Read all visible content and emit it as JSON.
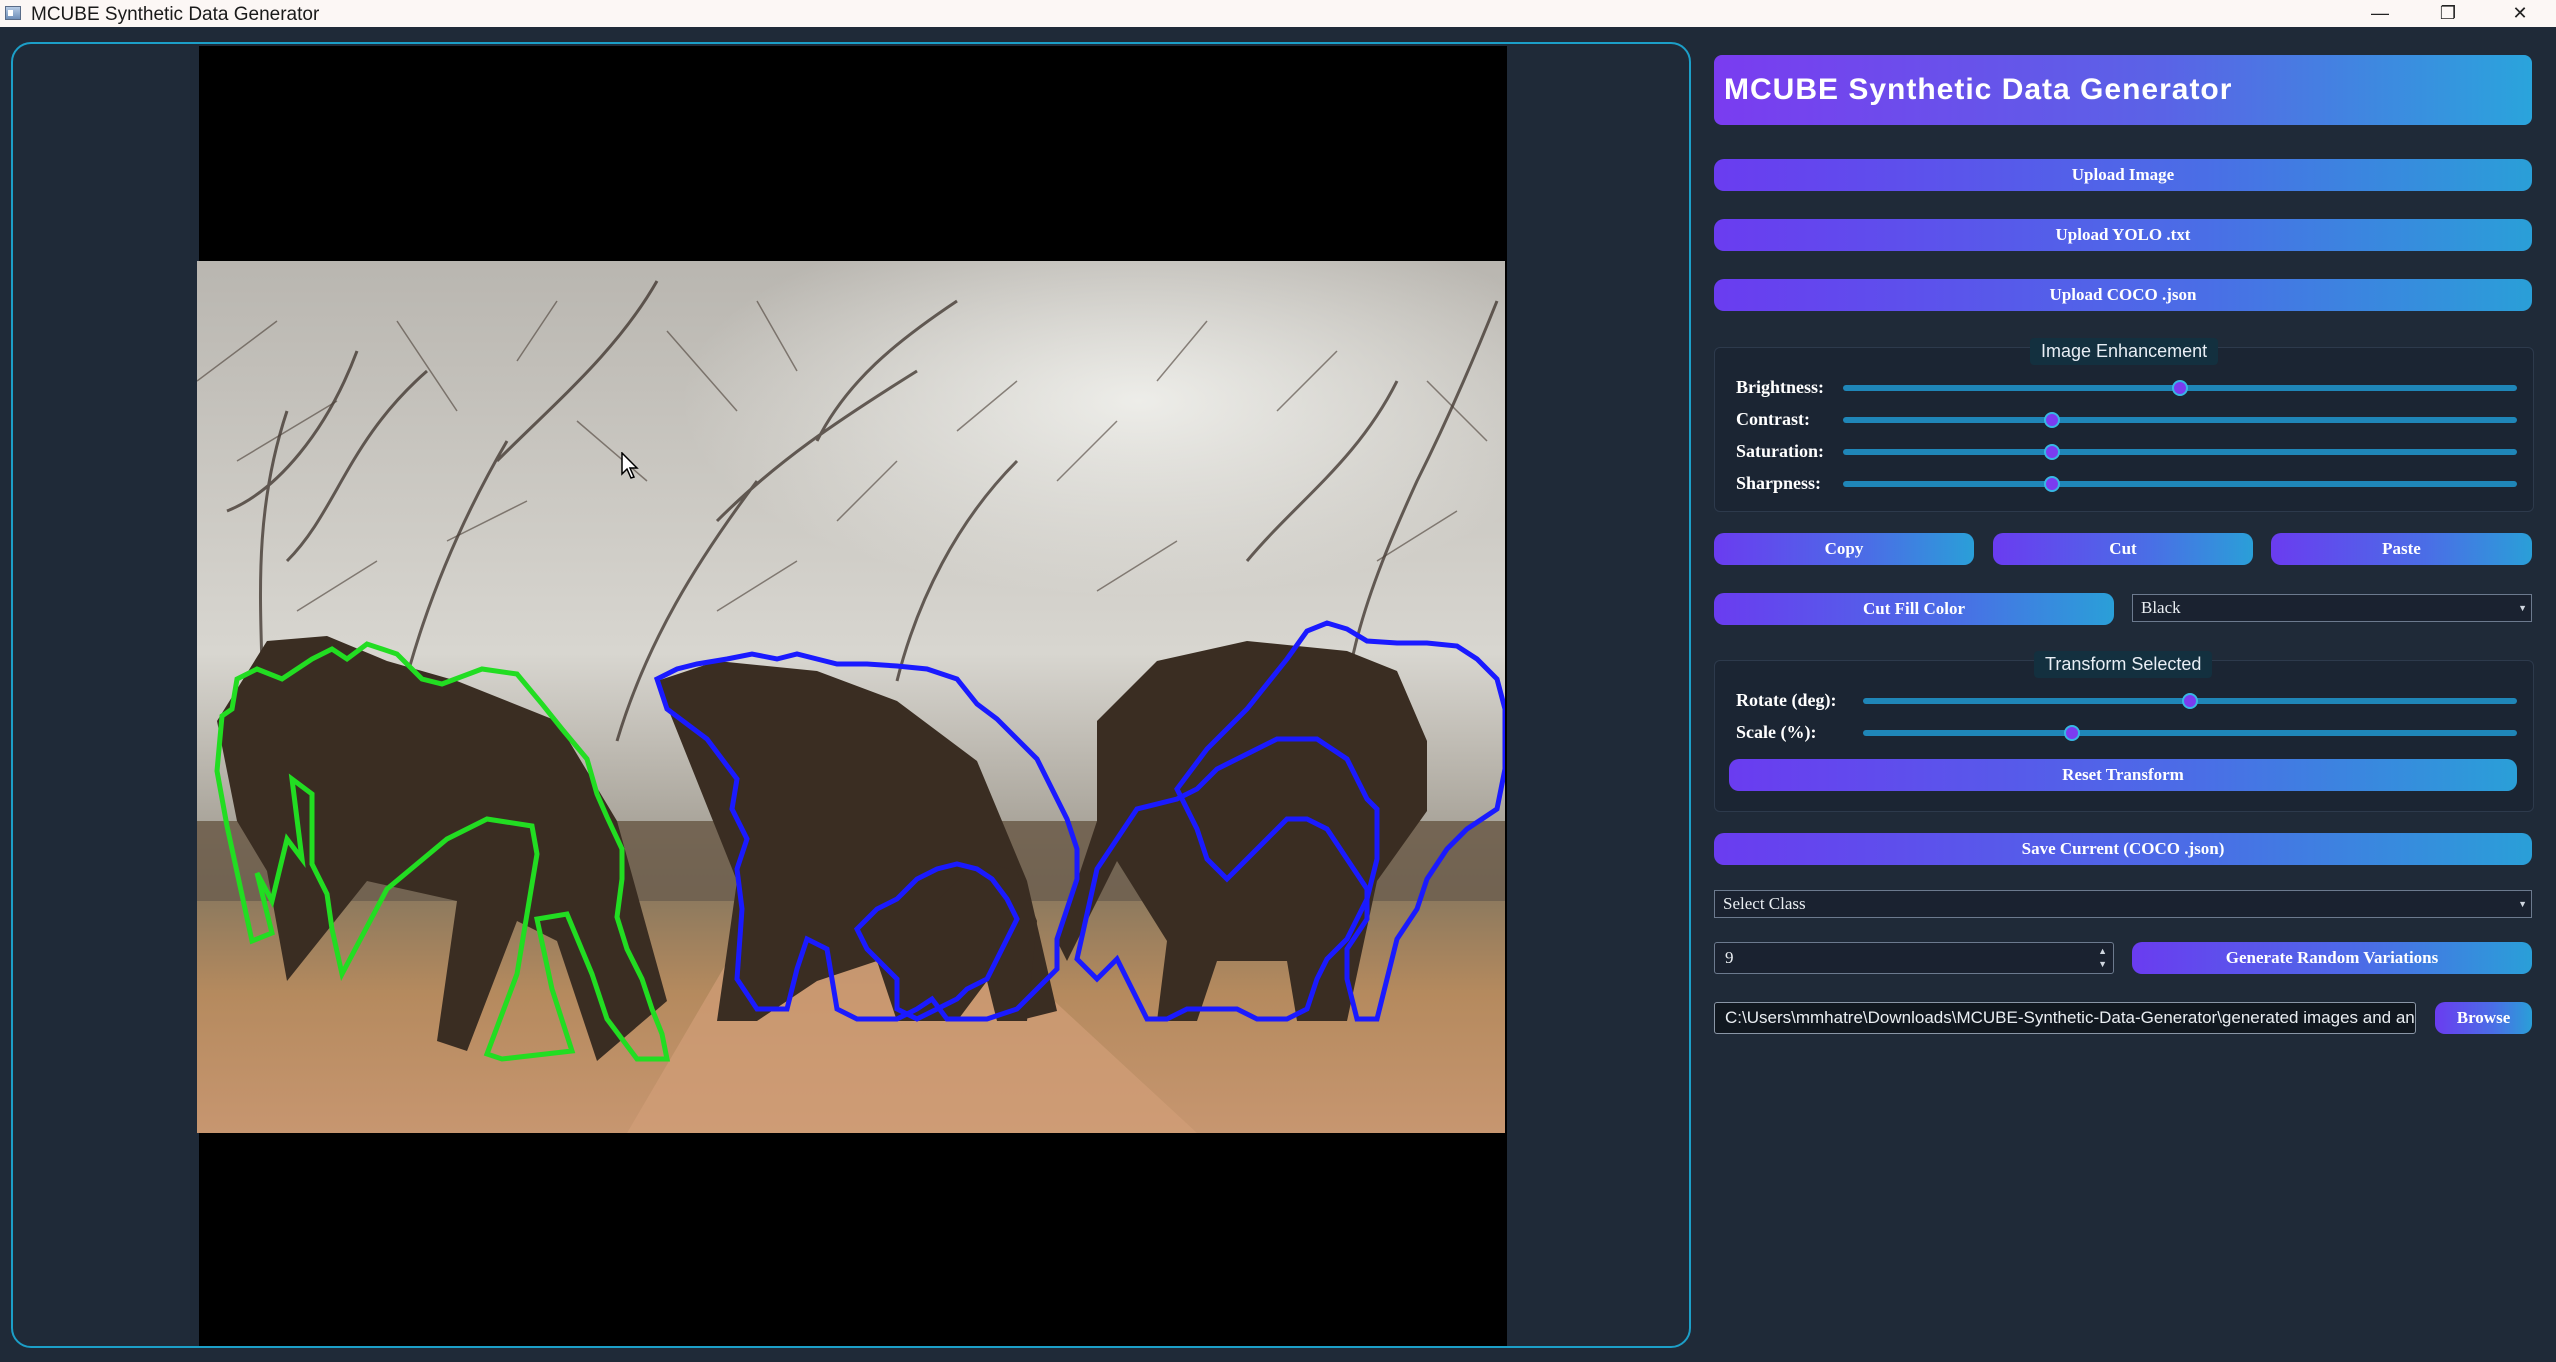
{
  "window": {
    "title": "MCUBE Synthetic Data Generator",
    "min_glyph": "—",
    "max_glyph": "❐",
    "close_glyph": "✕"
  },
  "header": {
    "title": "MCUBE Synthetic Data Generator"
  },
  "buttons": {
    "upload_image": "Upload Image",
    "upload_yolo": "Upload YOLO .txt",
    "upload_coco": "Upload COCO .json",
    "copy": "Copy",
    "cut": "Cut",
    "paste": "Paste",
    "cut_fill_color": "Cut Fill Color",
    "reset_transform": "Reset Transform",
    "save_current": "Save Current (COCO .json)",
    "generate": "Generate Random Variations",
    "browse": "Browse"
  },
  "enhancement": {
    "title": "Image Enhancement",
    "sliders": [
      {
        "label": "Brightness:",
        "value": 0.5
      },
      {
        "label": "Contrast:",
        "value": 0.31
      },
      {
        "label": "Saturation:",
        "value": 0.31
      },
      {
        "label": "Sharpness:",
        "value": 0.31
      }
    ]
  },
  "transform": {
    "title": "Transform Selected",
    "sliders": [
      {
        "label": "Rotate (deg):",
        "value": 0.5
      },
      {
        "label": "Scale (%):",
        "value": 0.32
      }
    ]
  },
  "fill_color": {
    "selected": "Black"
  },
  "class_select": {
    "selected": "Select Class"
  },
  "variations": {
    "count": "9"
  },
  "output_path": {
    "value": "C:\\Users\\mmhatre\\Downloads\\MCUBE-Synthetic-Data-Generator\\generated images and annos"
  },
  "colors": {
    "accent_purple": "#7a3cf0",
    "accent_blue": "#2aa4dc",
    "annotation_green": "#22dd22",
    "annotation_blue": "#1a1aff",
    "panel_bg": "#1f2a38"
  },
  "icons": {
    "app": "app-window-icon",
    "cursor": "mouse-pointer-icon",
    "dropdown": "chevron-down-icon",
    "spin_up": "spin-up-icon",
    "spin_down": "spin-down-icon"
  }
}
